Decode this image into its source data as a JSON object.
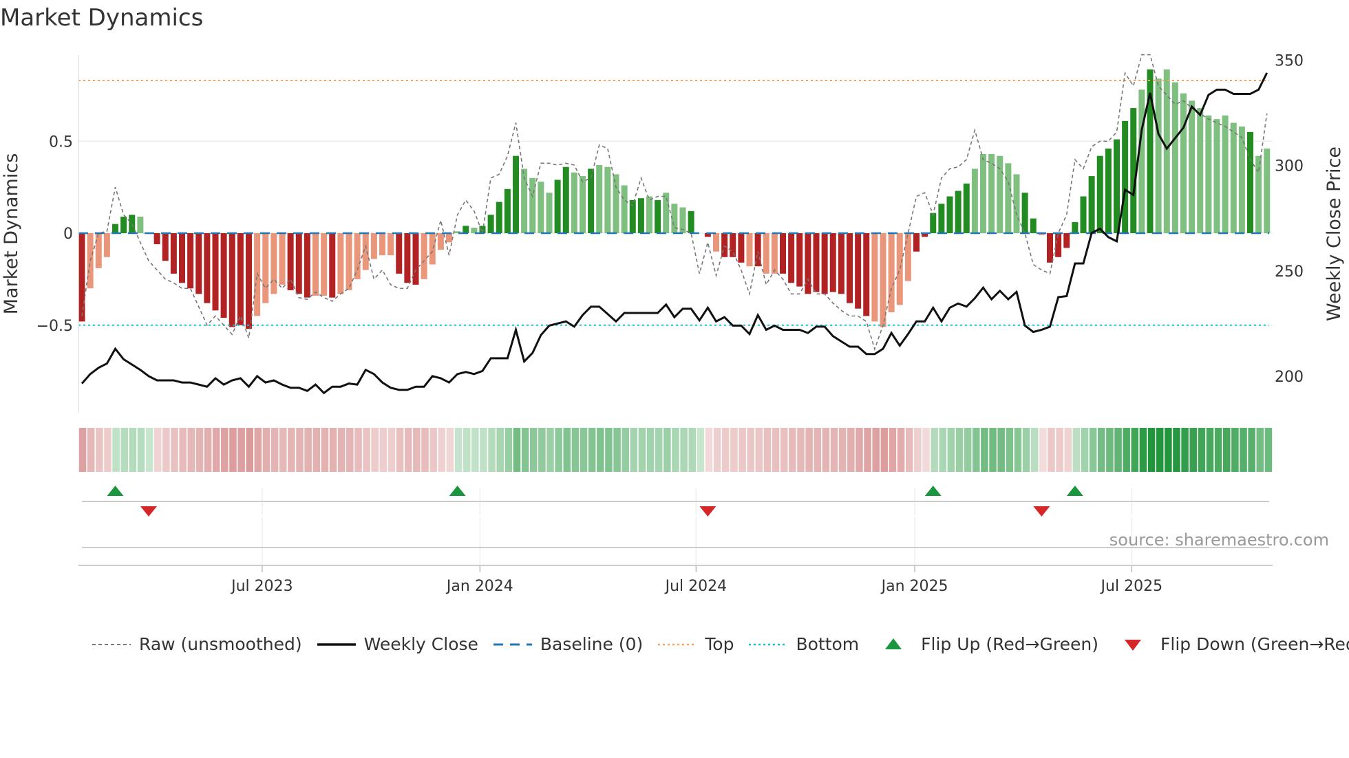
{
  "title": "Market Dynamics",
  "source": "source: sharemaestro.com",
  "colors": {
    "dark_red": "#b22222",
    "light_red": "#e9967a",
    "dark_green": "#228b22",
    "light_green": "#7fbf7f",
    "raw": "#777777",
    "close": "#111111",
    "baseline": "#1f77b4",
    "top": "#f4a460",
    "bottom": "#17becf",
    "flip_up": "#1a9641",
    "flip_down": "#d62728"
  },
  "chart_data": {
    "type": "bar",
    "title": "Market Dynamics",
    "ylabel": "Market Dynamics",
    "y2label": "Weekly Close Price",
    "ylim": [
      -0.98,
      0.97
    ],
    "y2lim": [
      180,
      355
    ],
    "yticks": [
      {
        "v": 0.5,
        "label": "0.5"
      },
      {
        "v": 0,
        "label": "0"
      },
      {
        "v": -0.5,
        "label": "−0.5"
      }
    ],
    "y2ticks": [
      {
        "v": 350,
        "label": "350"
      },
      {
        "v": 300,
        "label": "300"
      },
      {
        "v": 250,
        "label": "250"
      },
      {
        "v": 200,
        "label": "200"
      }
    ],
    "xticks": [
      {
        "week": 21.6,
        "label": "Jul 2023"
      },
      {
        "week": 47.7,
        "label": "Jan 2024"
      },
      {
        "week": 73.6,
        "label": "Jul 2024"
      },
      {
        "week": 99.8,
        "label": "Jan 2025"
      },
      {
        "week": 125.8,
        "label": "Jul 2025"
      }
    ],
    "top": 0.83,
    "bottom": -0.5,
    "baseline": 0,
    "bars": [
      -0.48,
      -0.3,
      -0.19,
      -0.13,
      0.05,
      0.09,
      0.1,
      0.09,
      0,
      -0.06,
      -0.15,
      -0.22,
      -0.27,
      -0.3,
      -0.33,
      -0.38,
      -0.42,
      -0.46,
      -0.51,
      -0.5,
      -0.52,
      -0.45,
      -0.38,
      -0.33,
      -0.28,
      -0.31,
      -0.33,
      -0.35,
      -0.34,
      -0.34,
      -0.35,
      -0.33,
      -0.31,
      -0.25,
      -0.2,
      -0.14,
      -0.12,
      -0.12,
      -0.22,
      -0.27,
      -0.28,
      -0.25,
      -0.17,
      -0.09,
      -0.05,
      0.01,
      0.04,
      0.03,
      0.04,
      0.1,
      0.17,
      0.24,
      0.42,
      0.35,
      0.3,
      0.28,
      0.22,
      0.29,
      0.36,
      0.33,
      0.31,
      0.35,
      0.37,
      0.36,
      0.32,
      0.26,
      0.18,
      0.19,
      0.2,
      0.18,
      0.22,
      0.16,
      0.14,
      0.12,
      0,
      -0.02,
      -0.1,
      -0.13,
      -0.13,
      -0.16,
      -0.18,
      -0.18,
      -0.22,
      -0.22,
      -0.22,
      -0.27,
      -0.29,
      -0.33,
      -0.32,
      -0.33,
      -0.32,
      -0.33,
      -0.38,
      -0.41,
      -0.45,
      -0.48,
      -0.51,
      -0.43,
      -0.39,
      -0.26,
      -0.1,
      -0.02,
      0.11,
      0.16,
      0.2,
      0.23,
      0.27,
      0.35,
      0.43,
      0.43,
      0.42,
      0.38,
      0.32,
      0.22,
      0.08,
      -0.01,
      -0.16,
      -0.13,
      -0.08,
      0.06,
      0.2,
      0.31,
      0.42,
      0.46,
      0.51,
      0.61,
      0.68,
      0.78,
      0.89,
      0.84,
      0.89,
      0.82,
      0.76,
      0.72,
      0.68,
      0.64,
      0.62,
      0.64,
      0.6,
      0.58,
      0.55,
      0.42,
      0.46
    ],
    "bar_shade": "dllldddldddddddddddddlllldddlldllllllldddllllldldddddllllddlldllllddldllldddldddldlldddddddddddllllldddddddllllllddldddddddddddldllllllllllld",
    "raw": [
      -0.45,
      -0.15,
      0.0,
      0.01,
      0.25,
      0.1,
      0.05,
      -0.05,
      -0.15,
      -0.2,
      -0.25,
      -0.27,
      -0.3,
      -0.3,
      -0.4,
      -0.5,
      -0.45,
      -0.5,
      -0.55,
      -0.45,
      -0.57,
      -0.22,
      -0.3,
      -0.25,
      -0.3,
      -0.25,
      -0.35,
      -0.36,
      -0.32,
      -0.35,
      -0.37,
      -0.33,
      -0.3,
      -0.2,
      -0.07,
      -0.25,
      -0.2,
      -0.28,
      -0.3,
      -0.3,
      -0.2,
      -0.15,
      -0.1,
      0.07,
      -0.12,
      0.1,
      0.18,
      0.12,
      0.0,
      0.3,
      0.32,
      0.42,
      0.6,
      0.3,
      0.2,
      0.38,
      0.38,
      0.37,
      0.38,
      0.37,
      0.28,
      0.3,
      0.48,
      0.46,
      0.25,
      0.18,
      0.15,
      0.3,
      0.18,
      0.2,
      0.2,
      0.03,
      0.02,
      0.0,
      -0.22,
      -0.05,
      -0.23,
      -0.07,
      -0.1,
      -0.2,
      -0.33,
      -0.1,
      -0.28,
      -0.2,
      -0.25,
      -0.33,
      -0.33,
      -0.25,
      -0.33,
      -0.33,
      -0.38,
      -0.42,
      -0.45,
      -0.45,
      -0.48,
      -0.63,
      -0.5,
      -0.3,
      -0.2,
      0.0,
      0.2,
      0.22,
      0.1,
      0.3,
      0.35,
      0.36,
      0.4,
      0.56,
      0.4,
      0.38,
      0.35,
      0.28,
      0.1,
      0.0,
      -0.17,
      -0.2,
      -0.22,
      0.0,
      0.1,
      0.4,
      0.35,
      0.47,
      0.5,
      0.5,
      0.55,
      0.87,
      0.8,
      0.97,
      0.97,
      0.8,
      0.75,
      0.7,
      0.72,
      0.68,
      0.65,
      0.62,
      0.6,
      0.58,
      0.55,
      0.52,
      0.4,
      0.33,
      0.65
    ],
    "close": [
      196.5,
      201,
      204,
      206,
      213,
      208,
      205.5,
      203,
      200,
      198,
      198,
      198,
      197,
      197,
      196,
      195,
      199,
      196,
      198,
      199,
      195,
      200,
      197,
      198,
      196,
      194.5,
      194.5,
      193,
      196,
      192,
      195,
      195,
      196.5,
      196,
      203,
      201,
      197,
      194.5,
      193.5,
      193.5,
      195,
      195,
      200,
      199,
      197,
      201,
      202,
      201,
      202.5,
      208.5,
      208.5,
      208.5,
      222,
      207,
      211,
      219.5,
      224,
      225,
      226,
      223.5,
      229,
      233,
      233,
      229.5,
      226,
      230,
      230,
      230,
      230,
      230,
      234,
      228,
      232,
      232,
      226.5,
      232.5,
      226,
      228,
      224,
      224,
      220,
      229,
      222,
      224,
      222,
      222,
      222,
      220.5,
      223.5,
      223.5,
      219,
      216.5,
      214,
      214,
      210.5,
      210.5,
      213,
      220.5,
      214.5,
      220,
      226,
      226,
      232.5,
      226,
      232.5,
      234.5,
      233,
      237,
      242,
      236.5,
      240.5,
      236.5,
      240,
      224,
      221,
      222,
      223.5,
      237.5,
      238,
      253.5,
      253.5,
      268,
      270,
      266,
      264,
      288.5,
      286,
      317,
      334.5,
      315,
      308,
      313,
      318,
      328,
      324,
      333.5,
      336,
      336,
      334,
      334,
      334,
      336,
      344
    ],
    "flips_up": [
      4,
      45,
      102,
      119
    ],
    "flips_down": [
      8,
      75,
      115
    ]
  },
  "legend": [
    {
      "key": "raw",
      "label": "Raw (unsmoothed)"
    },
    {
      "key": "close",
      "label": "Weekly Close"
    },
    {
      "key": "baseline",
      "label": "Baseline (0)"
    },
    {
      "key": "top",
      "label": "Top"
    },
    {
      "key": "bottom",
      "label": "Bottom"
    },
    {
      "key": "flip_up",
      "label": "Flip Up (Red→Green)"
    },
    {
      "key": "flip_down",
      "label": "Flip Down (Green→Red)"
    }
  ]
}
